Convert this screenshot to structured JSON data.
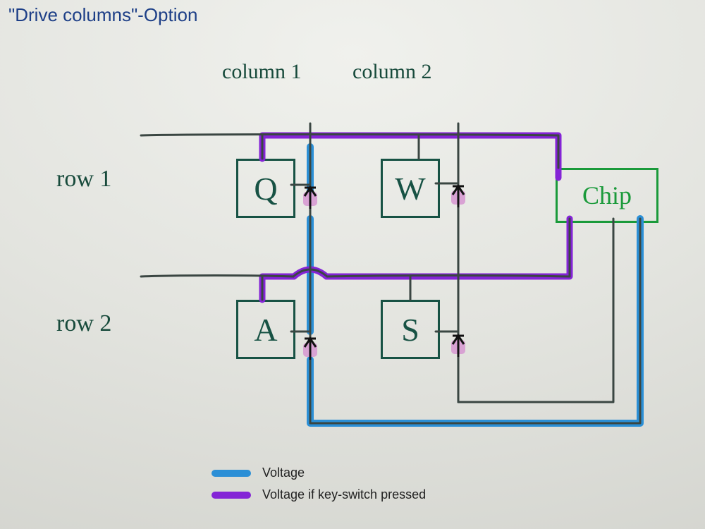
{
  "title": "\"Drive columns\"-Option",
  "columns": {
    "c1": "column 1",
    "c2": "column 2"
  },
  "rows": {
    "r1": "row 1",
    "r2": "row 2"
  },
  "keys": {
    "k11": "Q",
    "k12": "W",
    "k21": "A",
    "k22": "S"
  },
  "chip_label": "Chip",
  "legend": {
    "voltage": "Voltage",
    "voltage_pressed": "Voltage if key-switch pressed"
  },
  "colors": {
    "voltage": "#2b8fd6",
    "voltage_pressed": "#8424d6",
    "ink": "#174a3b",
    "chip": "#1a9a3a"
  }
}
